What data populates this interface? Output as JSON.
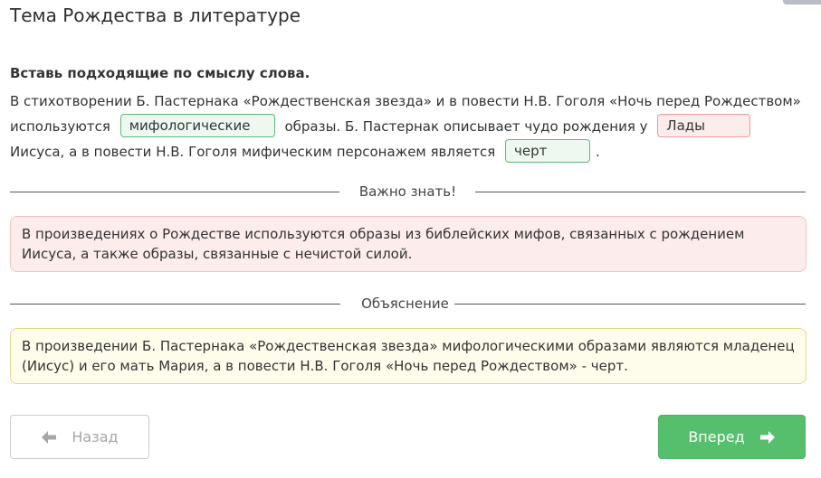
{
  "page": {
    "title": "Тема Рождества в литературе"
  },
  "task": {
    "instruction": "Вставь подходящие по смыслу слова.",
    "text_part1": "В стихотворении Б. Пастернака «Рождественская звезда» и в повести Н.В. Гоголя «Ночь перед Рождеством» используются",
    "blank1": "мифологические",
    "text_part2": "образы. Б. Пастернак описывает чудо рождения у",
    "blank2": "Лады",
    "text_part3": "Иисуса, а в повести Н.В. Гоголя мифическим персонажем является",
    "blank3": "черт",
    "text_part4": "."
  },
  "important": {
    "heading": "Важно знать!",
    "text": "В произведениях о Рождестве используются образы из библейских мифов, связанных с рождением Иисуса, а также образы, связанные с нечистой силой."
  },
  "explanation": {
    "heading": "Объяснение",
    "text": "В произведении Б. Пастернака «Рождественская звезда» мифологическими образами являются младенец (Иисус) и его мать Мария, а в повести Н.В. Гоголя «Ночь перед Рождеством» - черт."
  },
  "nav": {
    "back_label": "Назад",
    "next_label": "Вперед",
    "back_icon": "arrow-left-icon",
    "next_icon": "arrow-right-icon"
  },
  "colors": {
    "correct_border": "#5cb87a",
    "wrong_border": "#ef9a9a",
    "important_bg": "#fcecec",
    "explain_bg": "#fefdec",
    "next_button": "#55bf6e"
  }
}
